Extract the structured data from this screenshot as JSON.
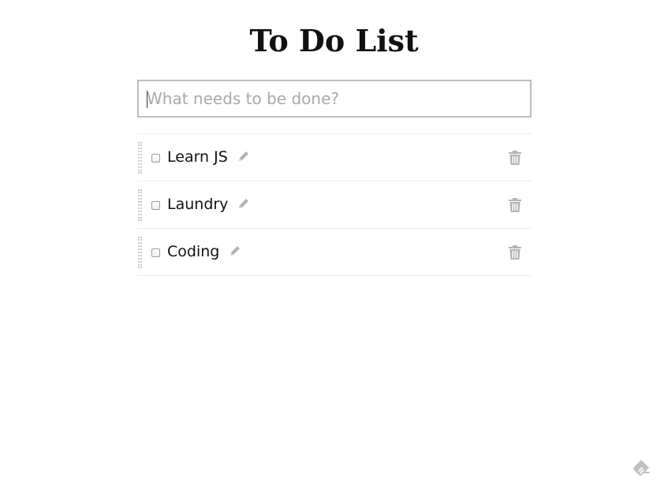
{
  "app": {
    "title": "To Do List"
  },
  "new_todo": {
    "placeholder": "What needs to be done?",
    "value": ""
  },
  "todos": [
    {
      "label": "Learn JS",
      "completed": false
    },
    {
      "label": "Laundry",
      "completed": false
    },
    {
      "label": "Coding",
      "completed": false
    }
  ],
  "icons": {
    "edit": "pencil-icon",
    "delete": "trash-icon",
    "drag": "drag-handle",
    "corner": "feedly-logo-icon"
  },
  "colors": {
    "title": "#111111",
    "input_border": "#bdbdbd",
    "placeholder": "#a9a9a9",
    "divider": "#ececec",
    "icon_gray": "#b3b3b3"
  }
}
